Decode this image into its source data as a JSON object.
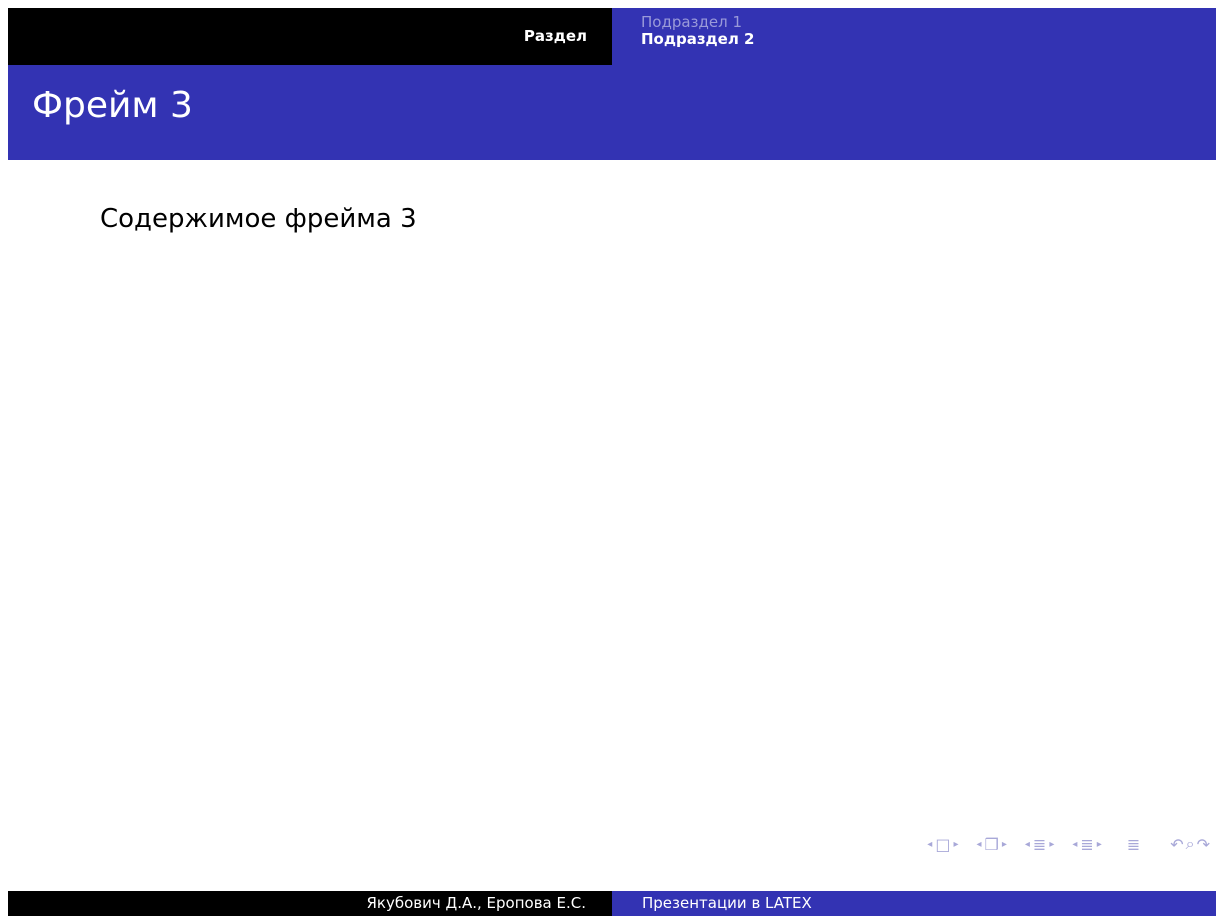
{
  "header": {
    "section": "Раздел",
    "subsections": [
      "Подраздел 1",
      "Подраздел 2"
    ]
  },
  "frame": {
    "title": "Фрейм 3",
    "content": "Содержимое фрейма 3"
  },
  "footer": {
    "authors": "Якубович Д.А., Еропова Е.С.",
    "presentation_title": "Презентации в LATEX"
  },
  "nav_symbols": {
    "frame_icon": "frame-nav-icon",
    "subsection_icon": "subsection-nav-icon",
    "section_icon": "section-nav-icon",
    "subsection_list_icon": "subsection-list-nav-icon",
    "toc_icon": "toc-icon",
    "search_icon": "search-icon",
    "back_icon": "back-icon"
  },
  "colors": {
    "header_left": "#000000",
    "accent": "#3333b3",
    "inactive_subsection": "#9a9ad9",
    "nav_symbols": "#a8a8d8"
  }
}
